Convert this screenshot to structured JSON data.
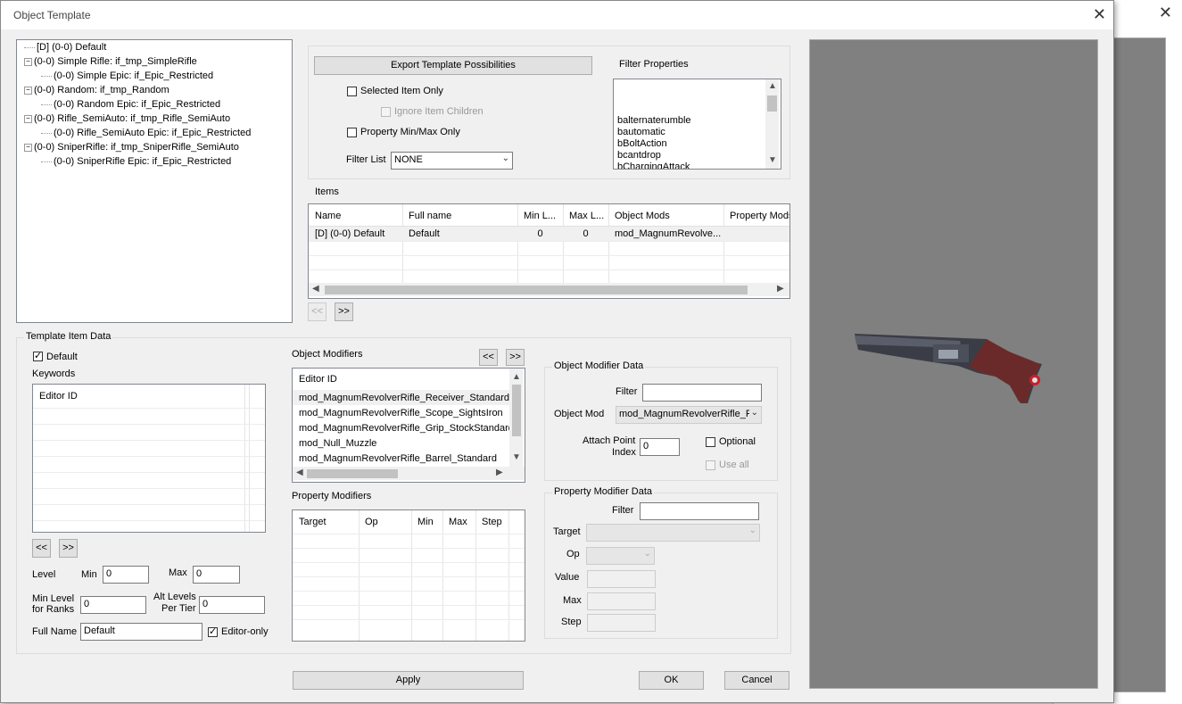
{
  "window": {
    "title": "Object Template",
    "close_glyph": "✕"
  },
  "tree": {
    "items": [
      {
        "label": "[D] (0-0) Default",
        "level": 0,
        "expander": false
      },
      {
        "label": "(0-0) Simple Rifle: if_tmp_SimpleRifle",
        "level": 0,
        "expander": true
      },
      {
        "label": "(0-0) Simple Epic: if_Epic_Restricted",
        "level": 1,
        "expander": false
      },
      {
        "label": "(0-0) Random: if_tmp_Random",
        "level": 0,
        "expander": true
      },
      {
        "label": "(0-0) Random Epic: if_Epic_Restricted",
        "level": 1,
        "expander": false
      },
      {
        "label": "(0-0) Rifle_SemiAuto: if_tmp_Rifle_SemiAuto",
        "level": 0,
        "expander": true
      },
      {
        "label": "(0-0) Rifle_SemiAuto Epic: if_Epic_Restricted",
        "level": 1,
        "expander": false
      },
      {
        "label": "(0-0) SniperRifle: if_tmp_SniperRifle_SemiAuto",
        "level": 0,
        "expander": true
      },
      {
        "label": "(0-0) SniperRifle Epic: if_Epic_Restricted",
        "level": 1,
        "expander": false
      }
    ]
  },
  "export": {
    "button_label": "Export Template Possibilities",
    "selected_item_only": "Selected Item Only",
    "ignore_item_children": "Ignore Item Children",
    "property_minmax_only": "Property Min/Max Only",
    "filter_list_label": "Filter List",
    "filter_list_value": "NONE",
    "filter_properties_label": "Filter Properties",
    "filter_properties": [
      "balternaterumble",
      "bautomatic",
      "bBoltAction",
      "bcantdrop",
      "bChargingAttack"
    ]
  },
  "items": {
    "label": "Items",
    "columns": [
      "Name",
      "Full name",
      "Min L...",
      "Max L...",
      "Object Mods",
      "Property Mods"
    ],
    "rows": [
      [
        "[D] (0-0) Default",
        "Default",
        "0",
        "0",
        "mod_MagnumRevolve...",
        ""
      ]
    ],
    "prev_btn": "<<",
    "next_btn": ">>"
  },
  "template_item": {
    "group_label": "Template Item Data",
    "default_label": "Default",
    "keywords_label": "Keywords",
    "keywords_header": "Editor ID",
    "prev_btn": "<<",
    "next_btn": ">>",
    "level_label": "Level",
    "min_label": "Min",
    "min_value": "0",
    "max_label": "Max",
    "max_value": "0",
    "min_level_label_1": "Min Level",
    "min_level_label_2": "for Ranks",
    "min_level_value": "0",
    "alt_levels_label_1": "Alt Levels",
    "alt_levels_label_2": "Per Tier",
    "alt_levels_value": "0",
    "full_name_label": "Full Name",
    "full_name_value": "Default",
    "editor_only_label": "Editor-only"
  },
  "object_modifiers": {
    "label": "Object Modifiers",
    "prev_btn": "<<",
    "next_btn": ">>",
    "header": "Editor ID",
    "rows": [
      "mod_MagnumRevolverRifle_Receiver_Standard",
      "mod_MagnumRevolverRifle_Scope_SightsIron",
      "mod_MagnumRevolverRifle_Grip_StockStandard",
      "mod_Null_Muzzle",
      "mod_MagnumRevolverRifle_Barrel_Standard"
    ]
  },
  "property_modifiers": {
    "label": "Property Modifiers",
    "columns": [
      "Target",
      "Op",
      "Min",
      "Max",
      "Step"
    ]
  },
  "object_modifier_data": {
    "group_label": "Object Modifier Data",
    "filter_label": "Filter",
    "filter_value": "",
    "object_mod_label": "Object Mod",
    "object_mod_value": "mod_MagnumRevolverRifle_R",
    "attach_label_1": "Attach Point",
    "attach_label_2": "Index",
    "attach_value": "0",
    "optional_label": "Optional",
    "use_all_label": "Use all"
  },
  "property_modifier_data": {
    "group_label": "Property Modifier Data",
    "filter_label": "Filter",
    "filter_value": "",
    "target_label": "Target",
    "op_label": "Op",
    "value_label": "Value",
    "max_label": "Max",
    "step_label": "Step"
  },
  "footer": {
    "apply": "Apply",
    "ok": "OK",
    "cancel": "Cancel"
  },
  "colors": {
    "preview_bg": "#808080",
    "selected_row": "#f0f0f0"
  }
}
